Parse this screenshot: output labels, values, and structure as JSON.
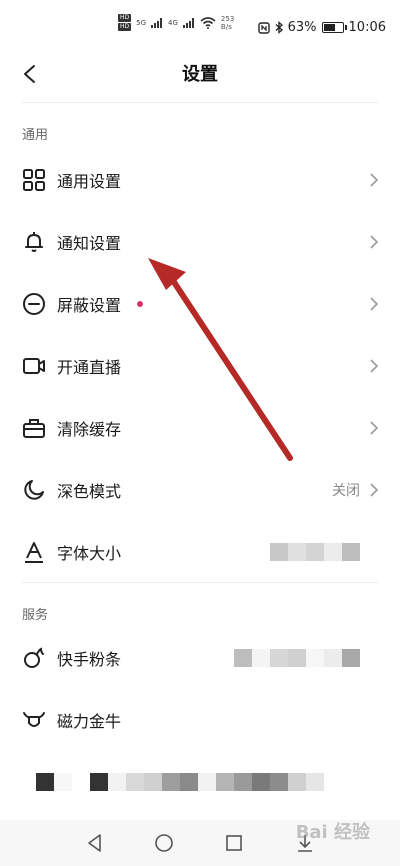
{
  "status_bar": {
    "hd1": "HD",
    "hd2": "HD",
    "net1": "5G",
    "net2": "4G",
    "speed_value": "253",
    "speed_unit": "B/s",
    "battery_percent": "63%",
    "battery_level": 0.63,
    "time": "10:06"
  },
  "header": {
    "title": "设置"
  },
  "sections": {
    "general": "通用",
    "service": "服务"
  },
  "rows": {
    "general_settings": "通用设置",
    "notification_settings": "通知设置",
    "block_settings": "屏蔽设置",
    "live": "开通直播",
    "clear_cache": "清除缓存",
    "dark_mode": "深色模式",
    "dark_mode_value": "关闭",
    "font_size": "字体大小",
    "fans": "快手粉条",
    "magnet": "磁力金牛"
  },
  "watermark": "Bai 经验",
  "colors": {
    "arrow": "#b52a26",
    "dot": "#e0306a"
  }
}
